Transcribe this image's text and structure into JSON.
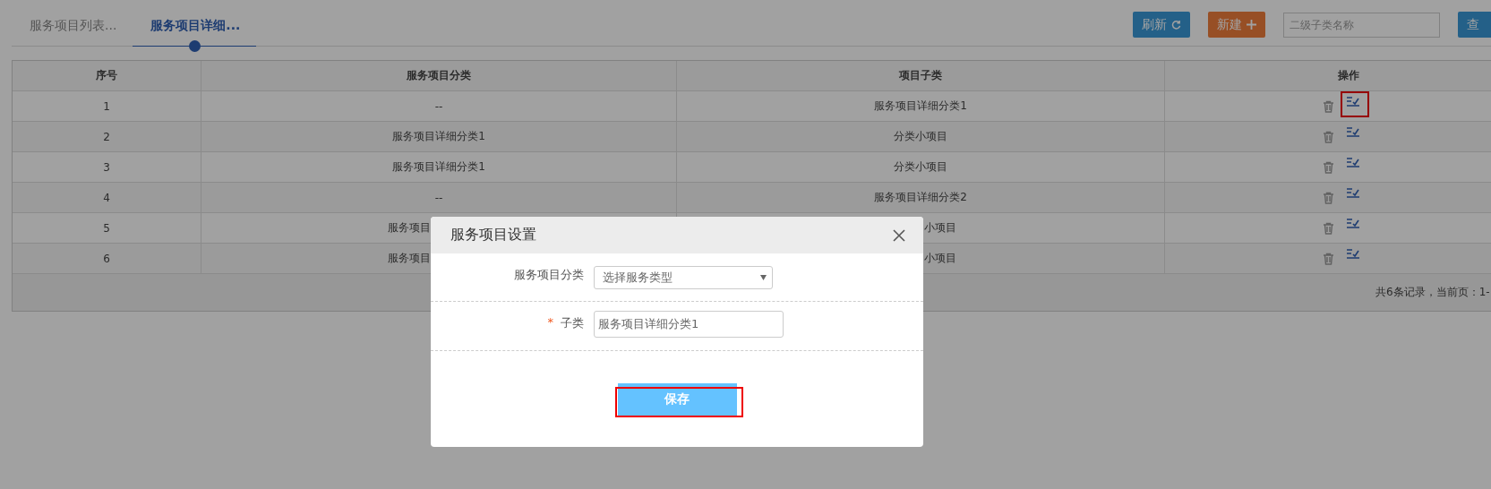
{
  "tabs": [
    {
      "label": "服务项目列表...",
      "selected": false
    },
    {
      "label": "服务项目详细...",
      "selected": true
    }
  ],
  "toolbar": {
    "refresh_button": "刷新",
    "new_button": "新建",
    "search": {
      "placeholder": "二级子类名称"
    },
    "query_button": "查"
  },
  "table": {
    "columns": [
      "序号",
      "服务项目分类",
      "项目子类",
      "操作"
    ],
    "rows": [
      {
        "cells": [
          {
            "text": "1"
          },
          {
            "text": "--"
          },
          {
            "text": "服务项目详细分类1"
          }
        ],
        "edit_highlighted": true
      },
      {
        "cells": [
          {
            "text": "2"
          },
          {
            "text": "服务项目详细分类1"
          },
          {
            "text": "分类小项目"
          }
        ],
        "edit_highlighted": false
      },
      {
        "cells": [
          {
            "text": "3"
          },
          {
            "text": "服务项目详细分类1"
          },
          {
            "text": "分类小项目"
          }
        ],
        "edit_highlighted": false
      },
      {
        "cells": [
          {
            "text": "4"
          },
          {
            "text": "--"
          },
          {
            "text": "服务项目详细分类2"
          }
        ],
        "edit_highlighted": false
      },
      {
        "cells": [
          {
            "text": "5"
          },
          {
            "text": "服务项目",
            "kind": "clipped_end"
          },
          {
            "text": "小项目",
            "kind": "clipped_start"
          }
        ],
        "edit_highlighted": false
      },
      {
        "cells": [
          {
            "text": "6"
          },
          {
            "text": "服务项目",
            "kind": "clipped_end"
          },
          {
            "text": "小项目",
            "kind": "clipped_start"
          }
        ],
        "edit_highlighted": false
      }
    ],
    "footer": "共6条记录，当前页：1-"
  },
  "dialog": {
    "title": "服务项目设置",
    "fields": [
      {
        "kind": "select",
        "label": "服务项目分类",
        "placeholder": "选择服务类型"
      },
      {
        "kind": "text",
        "label": "子类",
        "required_mark": "*",
        "value": "服务项目详细分类1"
      }
    ],
    "save_button": {
      "label": "保存",
      "highlighted": true
    }
  }
}
